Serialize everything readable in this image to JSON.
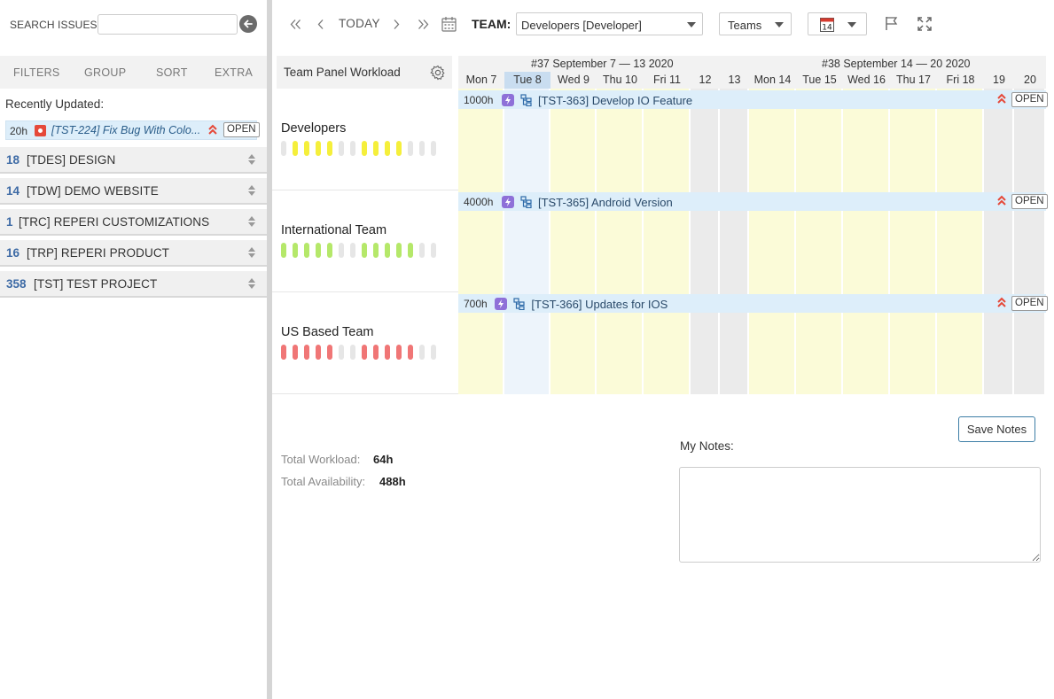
{
  "search": {
    "label": "SEARCH ISSUES:",
    "placeholder": "",
    "value": ""
  },
  "tabs": [
    {
      "label": "FILTERS"
    },
    {
      "label": "GROUP"
    },
    {
      "label": "SORT"
    },
    {
      "label": "EXTRA"
    }
  ],
  "recent": {
    "label": "Recently Updated:",
    "item": {
      "hours": "20h",
      "title": "[TST-224] Fix Bug With Colo...",
      "open_label": "OPEN",
      "type_icon": "bug-icon",
      "priority_icon": "highest-priority-icon"
    }
  },
  "projects": [
    {
      "count": "18",
      "name": "[TDES] DESIGN"
    },
    {
      "count": "14",
      "name": "[TDW] DEMO WEBSITE"
    },
    {
      "count": "1",
      "name": "[TRC] REPERI CUSTOMIZATIONS"
    },
    {
      "count": "16",
      "name": "[TRP] REPERI PRODUCT"
    },
    {
      "count": "358",
      "name": "[TST] TEST PROJECT"
    }
  ],
  "toolbar": {
    "today": "TODAY",
    "team_label": "TEAM:",
    "team_value": "Developers [Developer]",
    "teams_value": "Teams",
    "calendar_day": "14"
  },
  "panel": {
    "title": "Team Panel Workload"
  },
  "calendar": {
    "weeks": [
      {
        "label": "#37 September 7 — 13 2020"
      },
      {
        "label": "#38 September 14 — 20 2020"
      }
    ],
    "days": [
      {
        "label": "Mon 7",
        "kind": "work"
      },
      {
        "label": "Tue 8",
        "kind": "today"
      },
      {
        "label": "Wed 9",
        "kind": "work"
      },
      {
        "label": "Thu 10",
        "kind": "work"
      },
      {
        "label": "Fri 11",
        "kind": "work"
      },
      {
        "label": "12",
        "kind": "weekend"
      },
      {
        "label": "13",
        "kind": "weekend"
      },
      {
        "label": "Mon 14",
        "kind": "work"
      },
      {
        "label": "Tue 15",
        "kind": "work"
      },
      {
        "label": "Wed 16",
        "kind": "work"
      },
      {
        "label": "Thu 17",
        "kind": "work"
      },
      {
        "label": "Fri 18",
        "kind": "work"
      },
      {
        "label": "19",
        "kind": "weekend"
      },
      {
        "label": "20",
        "kind": "weekend"
      }
    ]
  },
  "teams": [
    {
      "name": "Developers",
      "bar_color": "#f5ef3b",
      "bar_pattern": [
        0,
        1,
        1,
        1,
        1,
        0,
        0,
        1,
        1,
        1,
        1,
        0,
        0,
        0
      ],
      "task": {
        "hours": "1000h",
        "title": "[TST-363] Develop IO Feature",
        "open_label": "OPEN"
      }
    },
    {
      "name": "International Team",
      "bar_color": "#b5e86a",
      "bar_pattern": [
        1,
        1,
        1,
        1,
        1,
        0,
        0,
        1,
        1,
        1,
        1,
        1,
        0,
        0
      ],
      "task": {
        "hours": "4000h",
        "title": "[TST-365] Android Version",
        "open_label": "OPEN"
      }
    },
    {
      "name": "US Based Team",
      "bar_color": "#f07676",
      "bar_pattern": [
        1,
        1,
        1,
        1,
        1,
        0,
        0,
        1,
        1,
        1,
        1,
        1,
        0,
        0
      ],
      "task": {
        "hours": "700h",
        "title": "[TST-366] Updates for IOS",
        "open_label": "OPEN"
      }
    }
  ],
  "stats": {
    "workload_label": "Total Workload:",
    "workload_value": "64h",
    "availability_label": "Total Availability:",
    "availability_value": "488h"
  },
  "notes": {
    "label": "My Notes:",
    "save_label": "Save Notes",
    "value": ""
  }
}
